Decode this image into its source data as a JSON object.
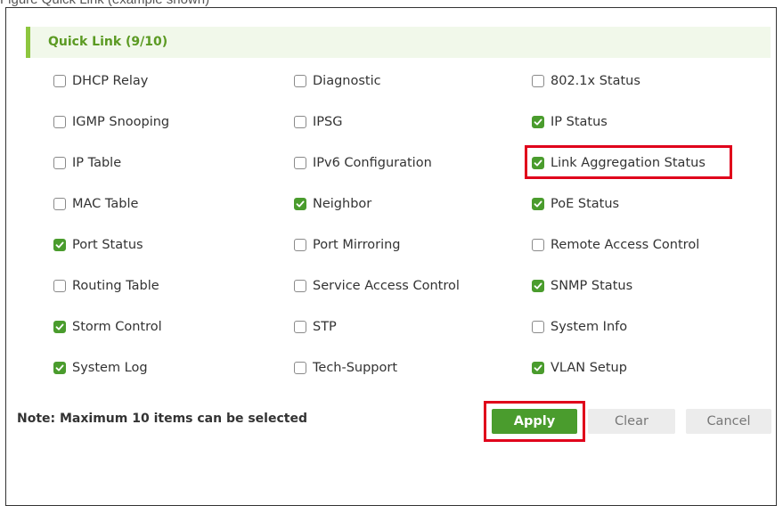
{
  "page": {
    "caption": "Figure  Quick Link (example shown)"
  },
  "quick_link": {
    "title": "Quick Link (9/10)",
    "columns": [
      [
        {
          "label": "DHCP Relay",
          "checked": false
        },
        {
          "label": "IGMP Snooping",
          "checked": false
        },
        {
          "label": "IP Table",
          "checked": false
        },
        {
          "label": "MAC Table",
          "checked": false
        },
        {
          "label": "Port Status",
          "checked": true
        },
        {
          "label": "Routing Table",
          "checked": false
        },
        {
          "label": "Storm Control",
          "checked": true
        },
        {
          "label": "System Log",
          "checked": true
        }
      ],
      [
        {
          "label": "Diagnostic",
          "checked": false
        },
        {
          "label": "IPSG",
          "checked": false
        },
        {
          "label": "IPv6 Configuration",
          "checked": false
        },
        {
          "label": "Neighbor",
          "checked": true
        },
        {
          "label": "Port Mirroring",
          "checked": false
        },
        {
          "label": "Service Access Control",
          "checked": false
        },
        {
          "label": "STP",
          "checked": false
        },
        {
          "label": "Tech-Support",
          "checked": false
        }
      ],
      [
        {
          "label": "802.1x Status",
          "checked": false
        },
        {
          "label": "IP Status",
          "checked": true
        },
        {
          "label": "Link Aggregation Status",
          "checked": true
        },
        {
          "label": "PoE Status",
          "checked": true
        },
        {
          "label": "Remote Access Control",
          "checked": false
        },
        {
          "label": "SNMP Status",
          "checked": true
        },
        {
          "label": "System Info",
          "checked": false
        },
        {
          "label": "VLAN Setup",
          "checked": true
        }
      ]
    ]
  },
  "footer": {
    "note": "Note: Maximum 10 items can be selected",
    "apply_label": "Apply",
    "clear_label": "Clear",
    "cancel_label": "Cancel"
  },
  "colors": {
    "accent_green": "#4a9c2d",
    "header_green": "#5b9a22",
    "highlight_red": "#e0001b"
  }
}
